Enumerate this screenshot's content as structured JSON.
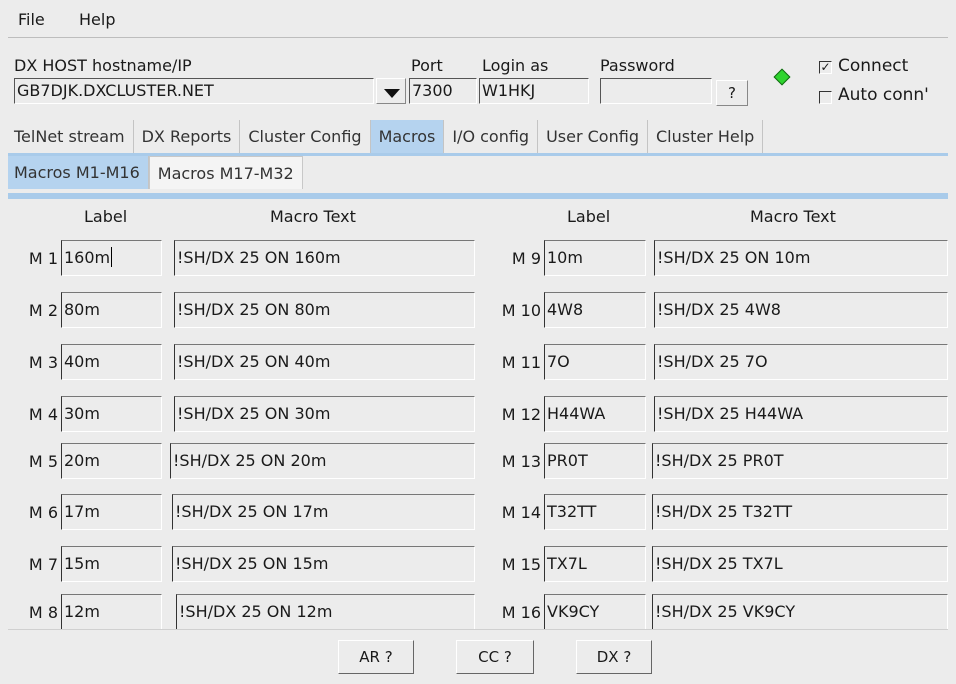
{
  "menu": {
    "file": "File",
    "help": "Help"
  },
  "host": {
    "hostname_label": "DX HOST hostname/IP",
    "hostname_value": "GB7DJK.DXCLUSTER.NET",
    "port_label": "Port",
    "port_value": "7300",
    "login_label": "Login as",
    "login_value": "W1HKJ",
    "password_label": "Password",
    "password_value": "",
    "help_btn": "?",
    "status_color": "#2ed42e",
    "connect_label": "Connect",
    "connect_checked": true,
    "autoconn_label": "Auto conn'",
    "autoconn_checked": false
  },
  "tabs": [
    {
      "label": "TelNet stream"
    },
    {
      "label": "DX Reports"
    },
    {
      "label": "Cluster Config"
    },
    {
      "label": "Macros",
      "active": true
    },
    {
      "label": "I/O config"
    },
    {
      "label": "User Config"
    },
    {
      "label": "Cluster Help"
    }
  ],
  "subtabs": [
    {
      "label": "Macros M1-M16",
      "active": true
    },
    {
      "label": "Macros M17-M32"
    }
  ],
  "headers": {
    "label": "Label",
    "text": "Macro Text"
  },
  "macros_left": [
    {
      "id": "M 1",
      "label": "160m",
      "text": "!SH/DX 25 ON 160m"
    },
    {
      "id": "M 2",
      "label": "80m",
      "text": "!SH/DX 25 ON 80m"
    },
    {
      "id": "M 3",
      "label": "40m",
      "text": "!SH/DX 25 ON 40m"
    },
    {
      "id": "M 4",
      "label": "30m",
      "text": "!SH/DX 25 ON 30m"
    },
    {
      "id": "M 5",
      "label": "20m",
      "text": "!SH/DX 25 ON 20m"
    },
    {
      "id": "M 6",
      "label": "17m",
      "text": "!SH/DX 25 ON 17m"
    },
    {
      "id": "M 7",
      "label": "15m",
      "text": "!SH/DX 25 ON 15m"
    },
    {
      "id": "M 8",
      "label": "12m",
      "text": "!SH/DX 25 ON 12m"
    }
  ],
  "macros_right": [
    {
      "id": "M 9",
      "label": "10m",
      "text": "!SH/DX 25 ON 10m"
    },
    {
      "id": "M 10",
      "label": "4W8",
      "text": "!SH/DX 25 4W8"
    },
    {
      "id": "M 11",
      "label": "7O",
      "text": "!SH/DX 25 7O"
    },
    {
      "id": "M 12",
      "label": "H44WA",
      "text": "!SH/DX 25 H44WA"
    },
    {
      "id": "M 13",
      "label": "PR0T",
      "text": "!SH/DX 25 PR0T"
    },
    {
      "id": "M 14",
      "label": "T32TT",
      "text": "!SH/DX 25 T32TT"
    },
    {
      "id": "M 15",
      "label": "TX7L",
      "text": "!SH/DX 25 TX7L"
    },
    {
      "id": "M 16",
      "label": "VK9CY",
      "text": "!SH/DX 25 VK9CY"
    }
  ],
  "footer": {
    "ar": "AR ?",
    "cc": "CC ?",
    "dx": "DX ?"
  }
}
